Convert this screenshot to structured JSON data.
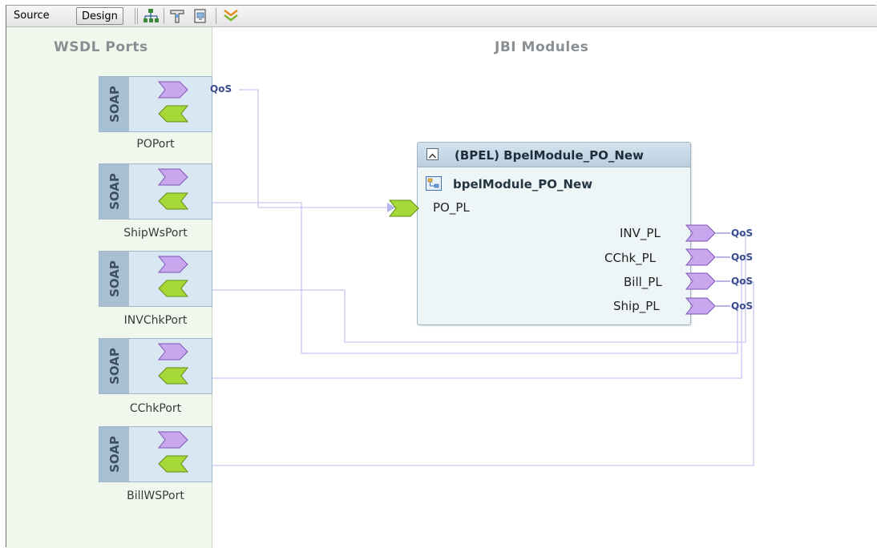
{
  "toolbar": {
    "source_label": "Source",
    "design_label": "Design",
    "icons": [
      "layout-icon",
      "build-icon",
      "deploy-icon",
      "expand-icon"
    ]
  },
  "canvas": {
    "wsdl_header": "WSDL Ports",
    "jbi_header": "JBI Modules"
  },
  "ports": [
    {
      "binding": "SOAP",
      "name": "POPort",
      "qos": "QoS"
    },
    {
      "binding": "SOAP",
      "name": "ShipWsPort"
    },
    {
      "binding": "SOAP",
      "name": "INVChkPort"
    },
    {
      "binding": "SOAP",
      "name": "CChkPort"
    },
    {
      "binding": "SOAP",
      "name": "BillWSPort"
    }
  ],
  "module": {
    "title": "(BPEL) BpelModule_PO_New",
    "subtitle": "bpelModule_PO_New",
    "consumes": [
      "PO_PL"
    ],
    "provides": [
      {
        "name": "INV_PL",
        "qos": "QoS"
      },
      {
        "name": "CChk_PL",
        "qos": "QoS"
      },
      {
        "name": "Bill_PL",
        "qos": "QoS"
      },
      {
        "name": "Ship_PL",
        "qos": "QoS"
      }
    ]
  },
  "colors": {
    "consumer_purple": "#c9a7ee",
    "provider_green": "#a6d838",
    "wire": "#c6c6f2",
    "wsdl_panel": "#f0f8ed",
    "soap_bar": "#a9bfd4"
  }
}
